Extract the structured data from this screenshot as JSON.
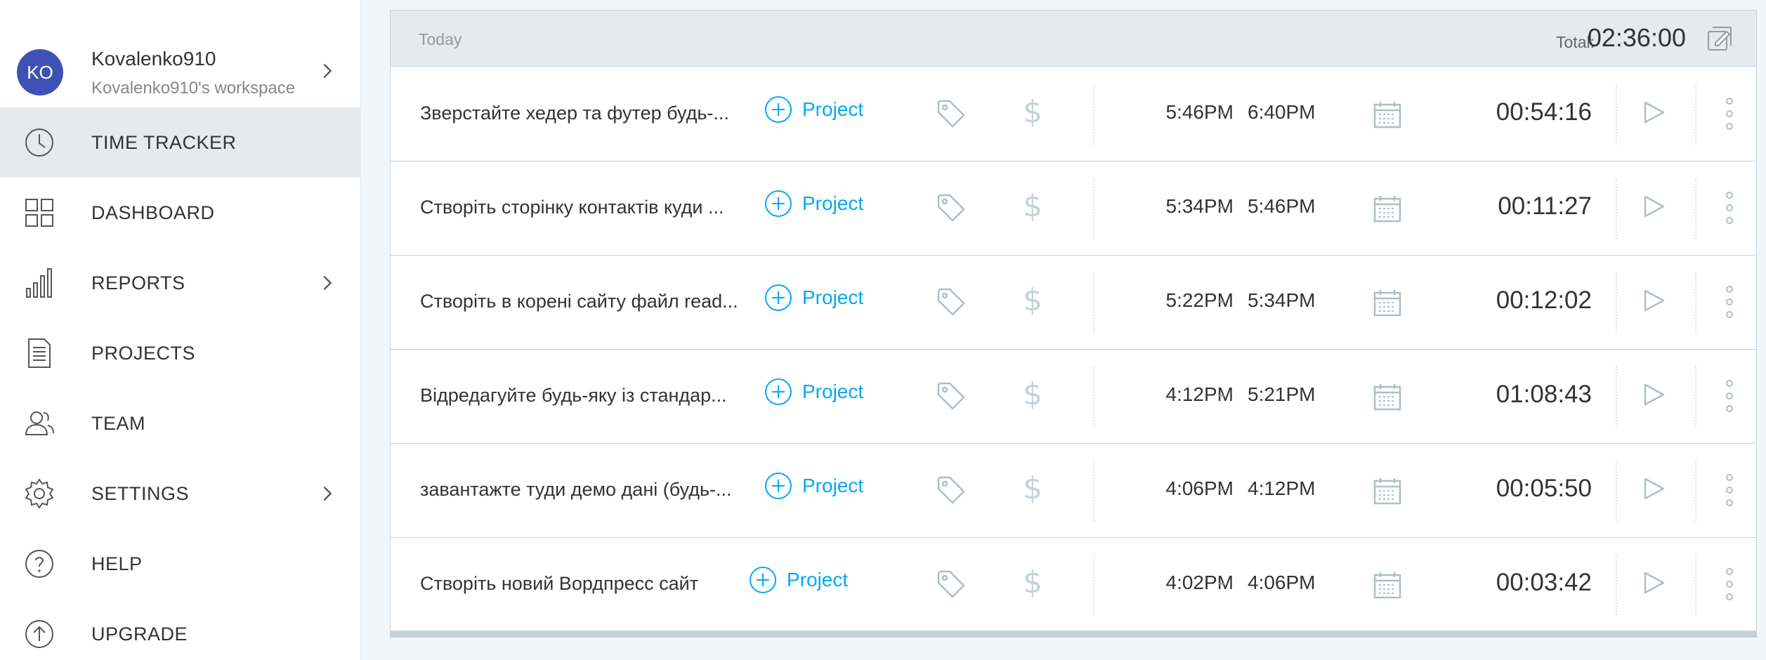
{
  "user": {
    "initials": "KO",
    "name": "Kovalenko910",
    "workspace": "Kovalenko910's workspace"
  },
  "nav": {
    "items": [
      {
        "label": "TIME TRACKER",
        "icon": "clock-icon",
        "active": true
      },
      {
        "label": "DASHBOARD",
        "icon": "dashboard-grid-icon"
      },
      {
        "label": "REPORTS",
        "icon": "bar-chart-icon",
        "chevron": true
      },
      {
        "label": "PROJECTS",
        "icon": "document-icon"
      },
      {
        "label": "TEAM",
        "icon": "team-icon"
      },
      {
        "label": "SETTINGS",
        "icon": "gear-icon",
        "chevron": true
      },
      {
        "label": "HELP",
        "icon": "help-circle-icon"
      },
      {
        "label": "UPGRADE",
        "icon": "upgrade-arrow-icon"
      }
    ]
  },
  "day": {
    "label": "Today",
    "total_label": "Total:",
    "total_value": "02:36:00"
  },
  "entries": [
    {
      "description": "Зверстайте хедер та футер будь-...",
      "project": "Project",
      "start": "5:46PM",
      "separator": "-",
      "end": "6:40PM",
      "duration": "00:54:16"
    },
    {
      "description": "Створіть сторінку контактів куди ...",
      "project": "Project",
      "start": "5:34PM",
      "separator": "-",
      "end": "5:46PM",
      "duration": "00:11:27"
    },
    {
      "description": "Створіть в корені сайту файл read...",
      "project": "Project",
      "start": "5:22PM",
      "separator": "-",
      "end": "5:34PM",
      "duration": "00:12:02"
    },
    {
      "description": "Відредагуйте будь-яку із стандар...",
      "project": "Project",
      "start": "4:12PM",
      "separator": "-",
      "end": "5:21PM",
      "duration": "01:08:43"
    },
    {
      "description": "завантажте туди демо дані (будь-...",
      "project": "Project",
      "start": "4:06PM",
      "separator": "-",
      "end": "4:12PM",
      "duration": "00:05:50"
    },
    {
      "description": "Створіть новий Вордпресс сайт",
      "project": "Project",
      "start": "4:02PM",
      "separator": "-",
      "end": "4:06PM",
      "duration": "00:03:42"
    }
  ],
  "colors": {
    "accent": "#03a9f4",
    "avatar": "#3f51b5",
    "icon_gray": "#b0bec5"
  }
}
